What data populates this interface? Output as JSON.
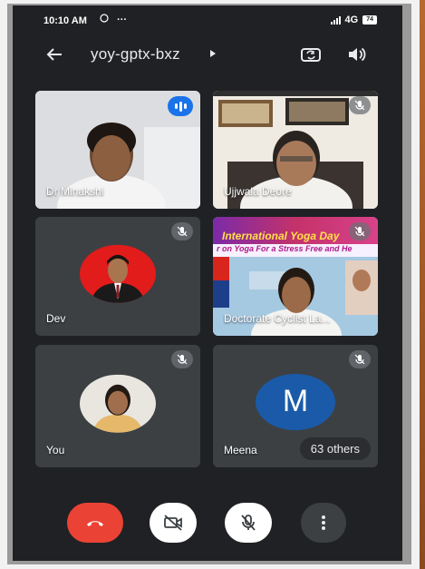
{
  "status_bar": {
    "time": "10:10 AM",
    "network": "4G",
    "battery": "74"
  },
  "header": {
    "meeting_code": "yoy-gptx-bxz"
  },
  "participants": [
    {
      "name": "Dr Minakshi",
      "muted": false,
      "speaking": true
    },
    {
      "name": "Ujjwala Deore",
      "muted": true
    },
    {
      "name": "Dev",
      "muted": true
    },
    {
      "name": "Doctorate Cyclist La...",
      "muted": true,
      "shared_banner": {
        "title": "International Yoga Day",
        "subtitle": "r on Yoga For a Stress Free and He"
      }
    },
    {
      "name": "You",
      "muted": true
    },
    {
      "name": "Meena",
      "muted": true,
      "avatar_letter": "M",
      "others_count": "63 others"
    }
  ],
  "controls": {
    "end_call": "end-call",
    "camera": "camera-off",
    "mic": "mic-off",
    "more": "more-options"
  },
  "colors": {
    "background": "#202124",
    "tile": "#3c4043",
    "end_call": "#ea4335",
    "speaking_badge": "#1a73e8",
    "avatar_m": "#1a5aa8"
  }
}
